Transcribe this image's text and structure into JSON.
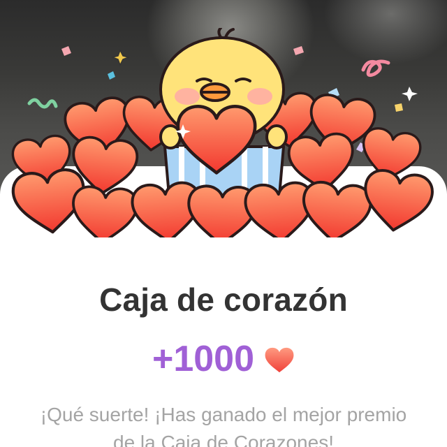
{
  "reward_popup": {
    "title": "Caja de corazón",
    "amount": "+1000",
    "message": "¡Qué suerte! ¡Has ganado el mejor premio de la Caja de Corazones!",
    "amount_icon": "heart-icon",
    "colors": {
      "title": "#333333",
      "amount": "#a060d6",
      "message": "#a4a4a4",
      "heart": "#ff5a4a"
    }
  }
}
